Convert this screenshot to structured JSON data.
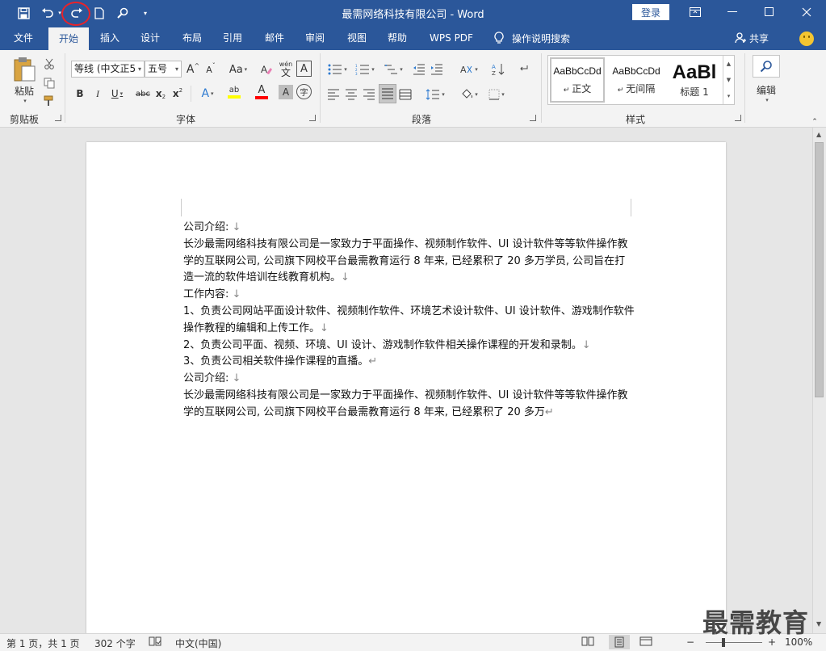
{
  "window": {
    "title": "最需网络科技有限公司 - Word",
    "login_label": "登录"
  },
  "tabs": [
    {
      "label": "文件"
    },
    {
      "label": "开始",
      "active": true
    },
    {
      "label": "插入"
    },
    {
      "label": "设计"
    },
    {
      "label": "布局"
    },
    {
      "label": "引用"
    },
    {
      "label": "邮件"
    },
    {
      "label": "审阅"
    },
    {
      "label": "视图"
    },
    {
      "label": "帮助"
    },
    {
      "label": "WPS PDF"
    }
  ],
  "tell_me": {
    "label": "操作说明搜索",
    "icon": "lightbulb-icon"
  },
  "share": {
    "label": "共享",
    "icon": "person-icon"
  },
  "ribbon": {
    "clipboard": {
      "group_label": "剪贴板",
      "paste_label": "粘贴"
    },
    "font": {
      "group_label": "字体",
      "font_name": "等线 (中文正5",
      "font_size": "五号",
      "grow_font": "A",
      "shrink_font": "A",
      "change_case": "Aa",
      "phonetic_top": "wén",
      "phonetic_bottom": "文",
      "char_border": "A",
      "bold": "B",
      "italic": "I",
      "underline": "U",
      "strikethrough": "abc",
      "subscript": "x",
      "superscript": "x",
      "text_effect": "A",
      "highlight": "ab",
      "font_color": "A",
      "char_shading": "A",
      "enclose": "字",
      "highlight_color": "#ffff00",
      "font_color_value": "#ff0000"
    },
    "paragraph": {
      "group_label": "段落"
    },
    "styles": {
      "group_label": "样式",
      "items": [
        {
          "preview": "AaBbCcDd",
          "name": "正文",
          "selected": true
        },
        {
          "preview": "AaBbCcDd",
          "name": "无间隔"
        },
        {
          "preview": "AaBl",
          "name": "标题 1"
        }
      ]
    },
    "editing": {
      "label": "编辑"
    }
  },
  "document": {
    "paragraphs": [
      {
        "text": "公司介绍: ",
        "mark": "↓"
      },
      {
        "text": "长沙最需网络科技有限公司是一家致力于平面操作、视频制作软件、UI 设计软件等等软件操作教学的互联网公司, 公司旗下网校平台最需教育运行 8 年来, 已经累积了 20 多万学员, 公司旨在打造一流的软件培训在线教育机构。",
        "mark": "↓"
      },
      {
        "text": "工作内容: ",
        "mark": "↓"
      },
      {
        "text": "1、负责公司网站平面设计软件、视频制作软件、环境艺术设计软件、UI 设计软件、游戏制作软件操作教程的编辑和上传工作。",
        "mark": "↓"
      },
      {
        "text": "2、负责公司平面、视频、环境、UI 设计、游戏制作软件相关操作课程的开发和录制。",
        "mark": "↓"
      },
      {
        "text": "3、负责公司相关软件操作课程的直播。",
        "mark": "↵"
      },
      {
        "text": "公司介绍: ",
        "mark": "↓"
      },
      {
        "text": "长沙最需网络科技有限公司是一家致力于平面操作、视频制作软件、UI 设计软件等等软件操作教学的互联网公司, 公司旗下网校平台最需教育运行 8 年来, 已经累积了 20 多万",
        "mark": "↵"
      }
    ]
  },
  "statusbar": {
    "page_info": "第 1 页，共 1 页",
    "word_count": "302 个字",
    "language": "中文(中国)",
    "zoom_minus": "−",
    "zoom_plus": "+",
    "zoom": "100%"
  },
  "watermark": "最需教育",
  "colors": {
    "accent": "#2b579a",
    "ribbon_bg": "#f3f3f3",
    "canvas_bg": "#e6e6e6",
    "annotation": "#e8232a"
  }
}
